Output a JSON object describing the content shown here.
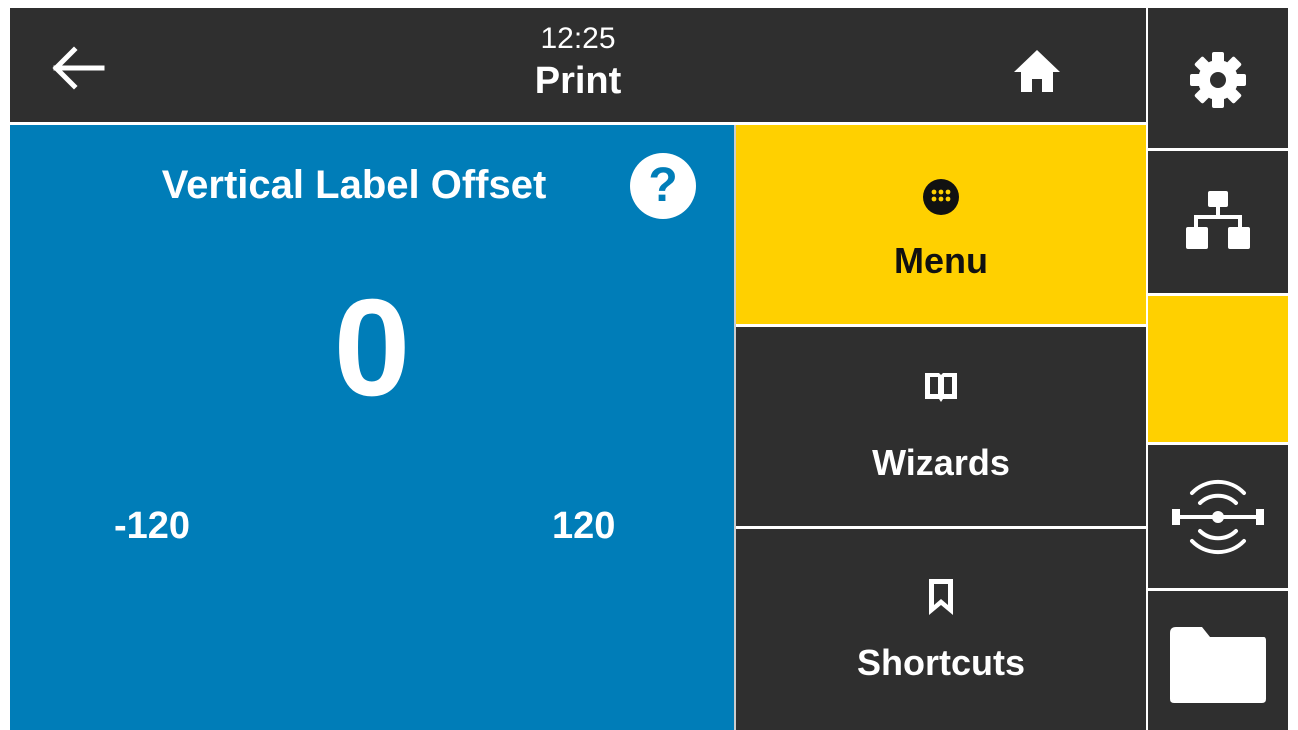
{
  "header": {
    "clock": "12:25",
    "title": "Print",
    "back_icon": "arrow-left-icon",
    "home_icon": "home-icon"
  },
  "setting": {
    "title": "Vertical Label Offset",
    "help_label": "?",
    "value": "0",
    "min": "-120",
    "max": "120"
  },
  "nav": {
    "menu": "Menu",
    "wizards": "Wizards",
    "shortcuts": "Shortcuts"
  },
  "sidebar": {
    "icons": [
      "gear-icon",
      "network-icon",
      "blank-status",
      "rfid-icon",
      "folder-icon"
    ]
  },
  "colors": {
    "panel_blue": "#007db8",
    "accent_yellow": "#ffd000",
    "dark": "#2f2f2f"
  }
}
